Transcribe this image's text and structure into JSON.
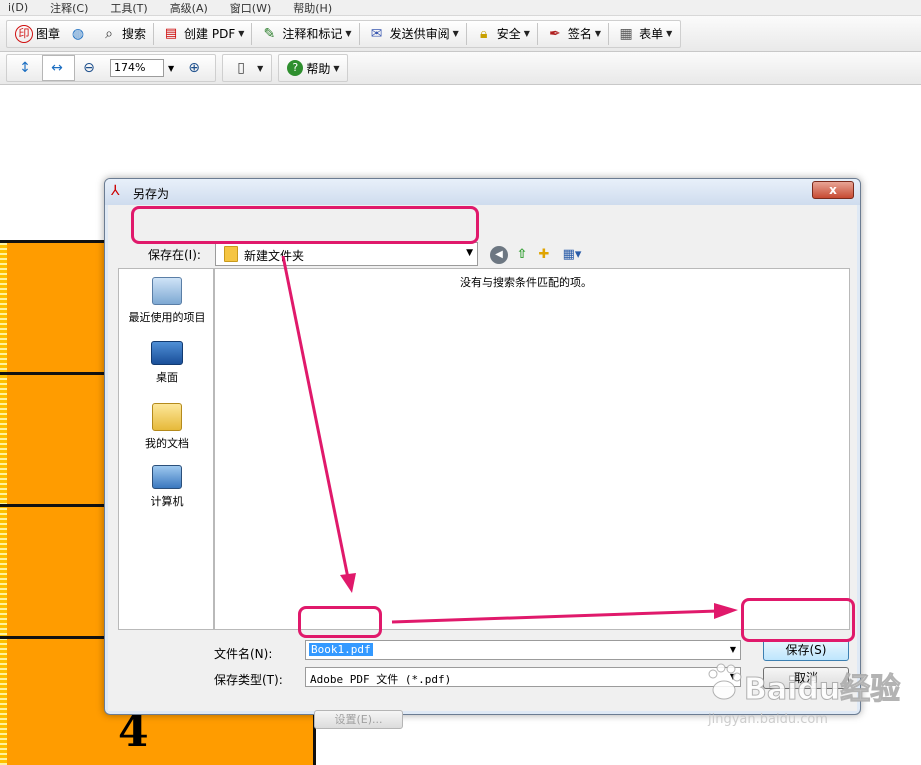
{
  "menu": [
    "i(D)",
    "注释(C)",
    "工具(T)",
    "高级(A)",
    "窗口(W)",
    "帮助(H)"
  ],
  "toolbar1": {
    "stamp": "图章",
    "search": "搜索",
    "create_pdf": "创建 PDF",
    "comment": "注释和标记",
    "send_review": "发送供审阅",
    "security": "安全",
    "sign": "签名",
    "forms": "表单"
  },
  "toolbar2": {
    "zoom": "174%",
    "help": "帮助"
  },
  "document": {
    "page_number": "4"
  },
  "dialog": {
    "title": "另存为",
    "close": "x",
    "save_in_label": "保存在(I):",
    "save_in_value": "新建文件夹",
    "places": [
      "最近使用的项目",
      "桌面",
      "我的文档",
      "计算机"
    ],
    "empty_message": "没有与搜索条件匹配的项。",
    "filename_label": "文件名(N):",
    "filename_value": "Book1.pdf",
    "filetype_label": "保存类型(T):",
    "filetype_value": "Adobe PDF 文件 (*.pdf)",
    "save_button": "保存(S)",
    "cancel_button": "取消",
    "settings_button": "设置(E)..."
  },
  "colors": {
    "highlight": "#e0196b",
    "doc_orange": "#ff9c00",
    "selection": "#3399ff"
  },
  "watermark": {
    "brand": "Baidu经验",
    "url": "jingyan.baidu.com"
  }
}
